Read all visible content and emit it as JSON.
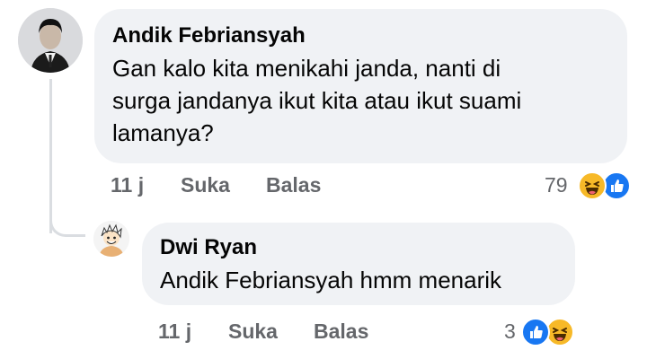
{
  "comment": {
    "author": "Andik Febriansyah",
    "text_lines": [
      "Gan kalo kita menikahi janda, nanti di",
      "surga jandanya ikut kita atau ikut suami",
      "lamanya?"
    ],
    "time": "11 j",
    "like_label": "Suka",
    "reply_label": "Balas",
    "reaction_count": "79",
    "reaction_icons": [
      "haha-icon",
      "like-icon"
    ]
  },
  "reply": {
    "author": "Dwi Ryan",
    "text": "Andik Febriansyah hmm menarik",
    "time": "11 j",
    "like_label": "Suka",
    "reply_label": "Balas",
    "reaction_count": "3",
    "reaction_icons": [
      "like-icon",
      "haha-icon"
    ]
  },
  "colors": {
    "bubble": "#f0f2f5",
    "meta_text": "#65676b",
    "like_blue": "#1877f2",
    "haha_yellow": "#f7b928",
    "thread_line": "#dadde1"
  }
}
